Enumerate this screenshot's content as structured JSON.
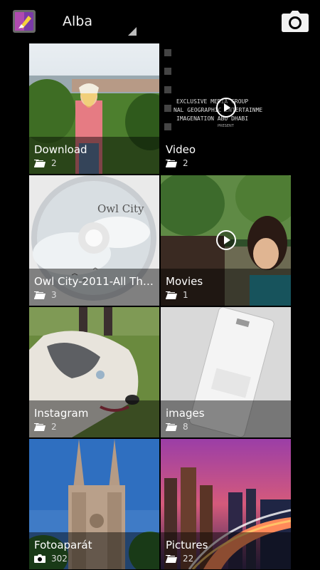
{
  "action_bar": {
    "title": "Alba"
  },
  "video_text": {
    "line1": "EXCLUSIVE MEDIA GROUP",
    "line2": "NAL GEOGRAPHIC ENTERTAINME",
    "line3": "IMAGENATION ABU DHABI",
    "line4": "PRESENT"
  },
  "cd_label": "Owl City",
  "albums": [
    {
      "title": "Download",
      "count": "2",
      "icon": "folder-icon",
      "has_play": false
    },
    {
      "title": "Video",
      "count": "2",
      "icon": "folder-icon",
      "has_play": true
    },
    {
      "title": "Owl City-2011-All Thing...",
      "count": "3",
      "icon": "folder-icon",
      "has_play": false
    },
    {
      "title": "Movies",
      "count": "1",
      "icon": "folder-icon",
      "has_play": true
    },
    {
      "title": "Instagram",
      "count": "2",
      "icon": "folder-icon",
      "has_play": false
    },
    {
      "title": "images",
      "count": "8",
      "icon": "folder-icon",
      "has_play": false
    },
    {
      "title": "Fotoaparát",
      "count": "302",
      "icon": "camera-small-icon",
      "has_play": false
    },
    {
      "title": "Pictures",
      "count": "22",
      "icon": "folder-icon",
      "has_play": false
    }
  ]
}
